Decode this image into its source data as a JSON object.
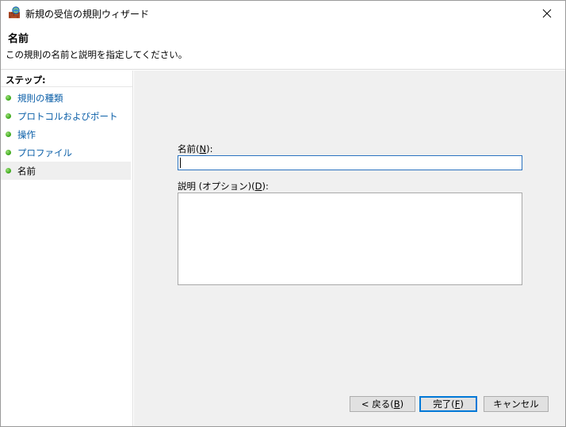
{
  "window": {
    "title": "新規の受信の規則ウィザード",
    "icon": "firewall-rule-icon"
  },
  "header": {
    "title": "名前",
    "description": "この規則の名前と説明を指定してください。"
  },
  "steps": {
    "heading": "ステップ:",
    "items": [
      {
        "label": "規則の種類",
        "current": false
      },
      {
        "label": "プロトコルおよびポート",
        "current": false
      },
      {
        "label": "操作",
        "current": false
      },
      {
        "label": "プロファイル",
        "current": false
      },
      {
        "label": "名前",
        "current": true
      }
    ]
  },
  "form": {
    "name_label": "名前(",
    "name_accel": "N",
    "name_label_end": "):",
    "name_value": "",
    "desc_label": "説明 (オプション)(",
    "desc_accel": "D",
    "desc_label_end": "):",
    "desc_value": ""
  },
  "buttons": {
    "back_prefix": "< 戻る(",
    "back_accel": "B",
    "back_suffix": ")",
    "finish_prefix": "完了(",
    "finish_accel": "F",
    "finish_suffix": ")",
    "cancel": "キャンセル"
  },
  "colors": {
    "link": "#0b5fa8",
    "step_dot": "#35a514",
    "content_bg": "#f0f0f0",
    "focus_border": "#2a72c0"
  }
}
